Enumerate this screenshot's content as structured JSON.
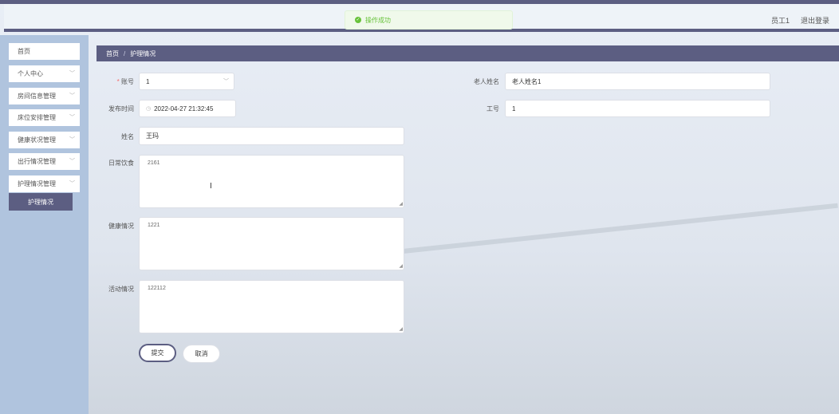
{
  "header": {
    "toast": "操作成功",
    "user": "员工1",
    "logout": "退出登录"
  },
  "sidebar": {
    "items": [
      {
        "label": "首页",
        "has_chevron": false
      },
      {
        "label": "个人中心",
        "has_chevron": true
      },
      {
        "label": "房间信息管理",
        "has_chevron": true
      },
      {
        "label": "床位安排管理",
        "has_chevron": true
      },
      {
        "label": "健康状况管理",
        "has_chevron": true
      },
      {
        "label": "出行情况管理",
        "has_chevron": true
      },
      {
        "label": "护理情况管理",
        "has_chevron": true
      }
    ],
    "active_sub": "护理情况"
  },
  "breadcrumb": {
    "home": "首页",
    "separator": "/",
    "current": "护理情况"
  },
  "form": {
    "account": {
      "label": "账号",
      "value": "1"
    },
    "elder_name": {
      "label": "老人姓名",
      "value": "老人姓名1"
    },
    "publish_time": {
      "label": "发布时间",
      "value": "2022-04-27 21:32:45"
    },
    "work_no": {
      "label": "工号",
      "value": "1"
    },
    "name": {
      "label": "姓名",
      "value": "王玛"
    },
    "diet": {
      "label": "日常饮食",
      "value": "2161"
    },
    "health": {
      "label": "健康情况",
      "value": "1221"
    },
    "activity": {
      "label": "活动情况",
      "value": "122112"
    },
    "submit": "提交",
    "cancel": "取消"
  },
  "colors": {
    "primary": "#5c5e82",
    "sidebar_bg": "#b0c4de",
    "success": "#67c23a"
  }
}
